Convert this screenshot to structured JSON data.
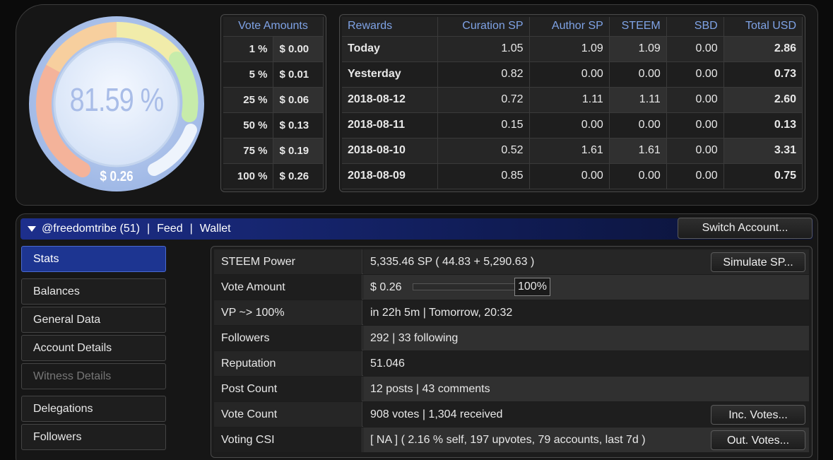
{
  "gauge": {
    "percent_text": "81.59 %",
    "usd_text": "$ 0.26",
    "percent": 81.59
  },
  "vote_amounts": {
    "header": "Vote Amounts",
    "rows": [
      {
        "pct": "1 %",
        "usd": "$ 0.00"
      },
      {
        "pct": "5 %",
        "usd": "$ 0.01"
      },
      {
        "pct": "25 %",
        "usd": "$ 0.06"
      },
      {
        "pct": "50 %",
        "usd": "$ 0.13"
      },
      {
        "pct": "75 %",
        "usd": "$ 0.19"
      },
      {
        "pct": "100 %",
        "usd": "$ 0.26"
      }
    ]
  },
  "rewards": {
    "headers": [
      "Rewards",
      "Curation SP",
      "Author SP",
      "STEEM",
      "SBD",
      "Total USD"
    ],
    "rows": [
      [
        "Today",
        "1.05",
        "1.09",
        "1.09",
        "0.00",
        "2.86"
      ],
      [
        "Yesterday",
        "0.82",
        "0.00",
        "0.00",
        "0.00",
        "0.73"
      ],
      [
        "2018-08-12",
        "0.72",
        "1.11",
        "1.11",
        "0.00",
        "2.60"
      ],
      [
        "2018-08-11",
        "0.15",
        "0.00",
        "0.00",
        "0.00",
        "0.13"
      ],
      [
        "2018-08-10",
        "0.52",
        "1.61",
        "1.61",
        "0.00",
        "3.31"
      ],
      [
        "2018-08-09",
        "0.85",
        "0.00",
        "0.00",
        "0.00",
        "0.75"
      ]
    ]
  },
  "account_bar": {
    "account": "@freedomtribe (51)",
    "separator": "|",
    "feed": "Feed",
    "wallet": "Wallet",
    "switch_label": "Switch Account..."
  },
  "sidebar": {
    "items": [
      {
        "label": "Stats",
        "state": "active"
      },
      {
        "label": "Balances",
        "state": "normal"
      },
      {
        "label": "General Data",
        "state": "normal"
      },
      {
        "label": "Account Details",
        "state": "normal"
      },
      {
        "label": "Witness Details",
        "state": "disabled"
      },
      {
        "label": "Delegations",
        "state": "normal"
      },
      {
        "label": "Followers",
        "state": "normal"
      }
    ]
  },
  "stats": {
    "steem_power": {
      "label": "STEEM Power",
      "value": "5,335.46 SP ( 44.83 + 5,290.63 )",
      "button": "Simulate SP..."
    },
    "vote_amount": {
      "label": "Vote Amount",
      "value": "$ 0.26",
      "weight_text": "100%",
      "weight": 100
    },
    "vp": {
      "label": "VP ~> 100%",
      "value": "in 22h 5m | Tomorrow, 20:32"
    },
    "followers": {
      "label": "Followers",
      "value": "292 | 33 following"
    },
    "reputation": {
      "label": "Reputation",
      "value": "51.046"
    },
    "post_count": {
      "label": "Post Count",
      "value": "12 posts | 43 comments"
    },
    "vote_count": {
      "label": "Vote Count",
      "value": "908 votes | 1,304 received",
      "button": "Inc. Votes..."
    },
    "voting_csi": {
      "label": "Voting CSI",
      "value": "[ NA ] ( 2.16 % self, 197 upvotes, 79 accounts, last 7d )",
      "button": "Out. Votes..."
    }
  }
}
